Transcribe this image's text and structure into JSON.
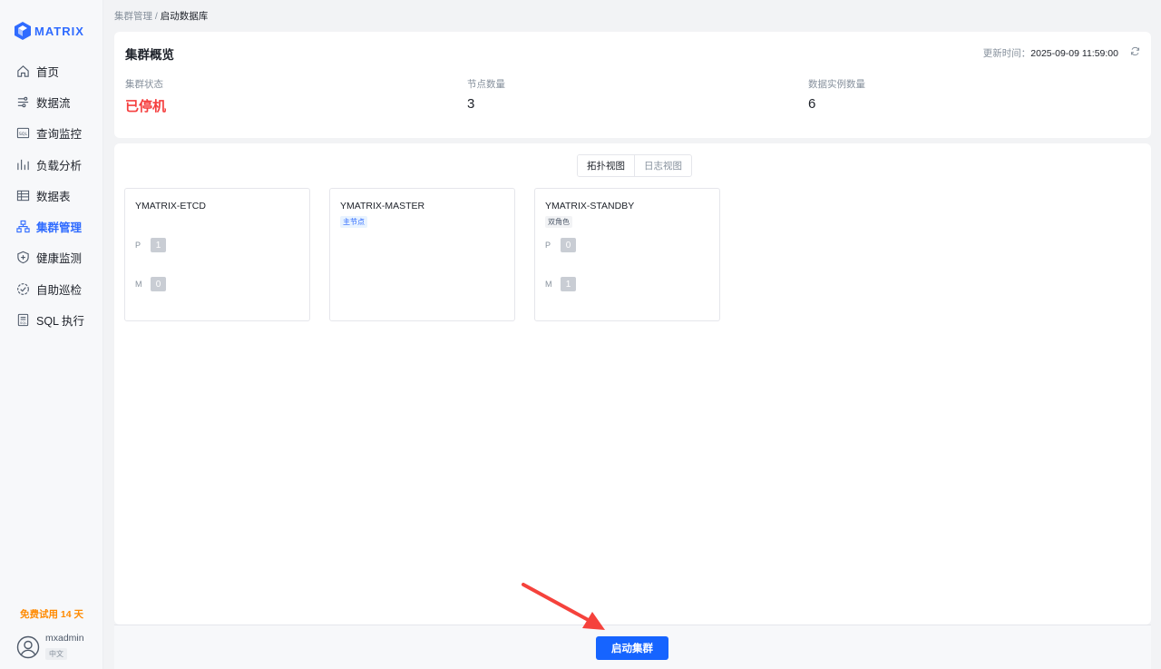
{
  "brand": {
    "name": "MATRIX"
  },
  "sidebar": {
    "items": [
      {
        "label": "首页",
        "icon": "home-icon"
      },
      {
        "label": "数据流",
        "icon": "flow-icon"
      },
      {
        "label": "查询监控",
        "icon": "sql-monitor-icon"
      },
      {
        "label": "负载分析",
        "icon": "bar-chart-icon"
      },
      {
        "label": "数据表",
        "icon": "table-icon"
      },
      {
        "label": "集群管理",
        "icon": "cluster-icon",
        "active": true
      },
      {
        "label": "健康监测",
        "icon": "shield-icon"
      },
      {
        "label": "自助巡检",
        "icon": "inspect-icon"
      },
      {
        "label": "SQL 执行",
        "icon": "sql-file-icon"
      }
    ],
    "trial": "免费试用 14 天",
    "user": {
      "name": "mxadmin",
      "lang": "中文"
    }
  },
  "breadcrumb": {
    "parent": "集群管理",
    "sep": "/",
    "current": "启动数据库"
  },
  "overview": {
    "title": "集群概览",
    "updated_label": "更新时间：",
    "updated_time": "2025-09-09 11:59:00",
    "stats": [
      {
        "label": "集群状态",
        "value": "已停机"
      },
      {
        "label": "节点数量",
        "value": "3"
      },
      {
        "label": "数据实例数量",
        "value": "6"
      }
    ]
  },
  "view_tabs": {
    "topology": "拓扑视图",
    "log": "日志视图"
  },
  "nodes": [
    {
      "name": "YMATRIX-ETCD",
      "tag": "",
      "p": "1",
      "m": "0"
    },
    {
      "name": "YMATRIX-MASTER",
      "tag": "主节点"
    },
    {
      "name": "YMATRIX-STANDBY",
      "tag": "双角色",
      "p": "0",
      "m": "1"
    }
  ],
  "segment_labels": {
    "p": "P",
    "m": "M"
  },
  "footer": {
    "start_button": "启动集群"
  },
  "colors": {
    "accent": "#1664ff",
    "stopped": "#f53f3f",
    "trial": "#ff8a00",
    "arrow": "#f5423c"
  }
}
